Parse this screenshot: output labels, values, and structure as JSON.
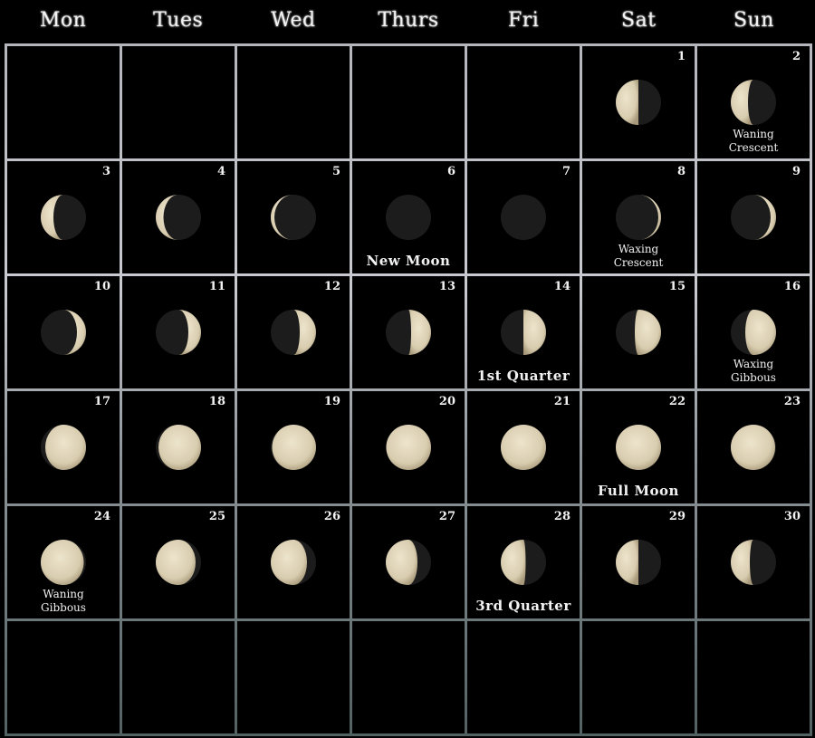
{
  "weekdays": [
    "Mon",
    "Tues",
    "Wed",
    "Thurs",
    "Fri",
    "Sat",
    "Sun"
  ],
  "colors": {
    "background": "#000000",
    "text": "#f2f2f2",
    "moon_lit": "#d9cdb0",
    "moon_dark": "#1c1c1c"
  },
  "weeks": [
    [
      null,
      null,
      null,
      null,
      null,
      {
        "day": "1",
        "phase": "third-quarter",
        "illum": 0.5,
        "waxing": false,
        "label": ""
      },
      {
        "day": "2",
        "phase": "waning-crescent",
        "illum": 0.38,
        "waxing": false,
        "label": "Waning Crescent"
      }
    ],
    [
      {
        "day": "3",
        "phase": "waning-crescent",
        "illum": 0.28,
        "waxing": false,
        "label": ""
      },
      {
        "day": "4",
        "phase": "waning-crescent",
        "illum": 0.17,
        "waxing": false,
        "label": ""
      },
      {
        "day": "5",
        "phase": "waning-crescent",
        "illum": 0.08,
        "waxing": false,
        "label": ""
      },
      {
        "day": "6",
        "phase": "new-moon",
        "illum": 0.0,
        "waxing": true,
        "label": "New Moon"
      },
      {
        "day": "7",
        "phase": "new-moon",
        "illum": 0.0,
        "waxing": true,
        "label": ""
      },
      {
        "day": "8",
        "phase": "waxing-crescent",
        "illum": 0.06,
        "waxing": true,
        "label": "Waxing Crescent"
      },
      {
        "day": "9",
        "phase": "waxing-crescent",
        "illum": 0.12,
        "waxing": true,
        "label": ""
      }
    ],
    [
      {
        "day": "10",
        "phase": "waxing-crescent",
        "illum": 0.2,
        "waxing": true,
        "label": ""
      },
      {
        "day": "11",
        "phase": "waxing-crescent",
        "illum": 0.28,
        "waxing": true,
        "label": ""
      },
      {
        "day": "12",
        "phase": "waxing-crescent",
        "illum": 0.36,
        "waxing": true,
        "label": ""
      },
      {
        "day": "13",
        "phase": "waxing-crescent",
        "illum": 0.44,
        "waxing": true,
        "label": ""
      },
      {
        "day": "14",
        "phase": "first-quarter",
        "illum": 0.5,
        "waxing": true,
        "label": "1st Quarter"
      },
      {
        "day": "15",
        "phase": "waxing-gibbous",
        "illum": 0.58,
        "waxing": true,
        "label": ""
      },
      {
        "day": "16",
        "phase": "waxing-gibbous",
        "illum": 0.68,
        "waxing": true,
        "label": "Waxing Gibbous"
      }
    ],
    [
      {
        "day": "17",
        "phase": "waxing-gibbous",
        "illum": 0.9,
        "waxing": true,
        "label": ""
      },
      {
        "day": "18",
        "phase": "waxing-gibbous",
        "illum": 0.94,
        "waxing": true,
        "label": ""
      },
      {
        "day": "19",
        "phase": "waxing-gibbous",
        "illum": 0.97,
        "waxing": true,
        "label": ""
      },
      {
        "day": "20",
        "phase": "waxing-gibbous",
        "illum": 0.99,
        "waxing": true,
        "label": ""
      },
      {
        "day": "21",
        "phase": "full-moon",
        "illum": 1.0,
        "waxing": true,
        "label": ""
      },
      {
        "day": "22",
        "phase": "full-moon",
        "illum": 1.0,
        "waxing": true,
        "label": "Full Moon"
      },
      {
        "day": "23",
        "phase": "waning-gibbous",
        "illum": 0.98,
        "waxing": false,
        "label": ""
      }
    ],
    [
      {
        "day": "24",
        "phase": "waning-gibbous",
        "illum": 0.95,
        "waxing": false,
        "label": "Waning Gibbous"
      },
      {
        "day": "25",
        "phase": "waning-gibbous",
        "illum": 0.88,
        "waxing": false,
        "label": ""
      },
      {
        "day": "26",
        "phase": "waning-gibbous",
        "illum": 0.8,
        "waxing": false,
        "label": ""
      },
      {
        "day": "27",
        "phase": "waning-gibbous",
        "illum": 0.7,
        "waxing": false,
        "label": ""
      },
      {
        "day": "28",
        "phase": "third-quarter",
        "illum": 0.55,
        "waxing": false,
        "label": "3rd Quarter"
      },
      {
        "day": "29",
        "phase": "third-quarter",
        "illum": 0.5,
        "waxing": false,
        "label": ""
      },
      {
        "day": "30",
        "phase": "waning-crescent",
        "illum": 0.42,
        "waxing": false,
        "label": ""
      }
    ],
    [
      null,
      null,
      null,
      null,
      null,
      null,
      null
    ]
  ]
}
